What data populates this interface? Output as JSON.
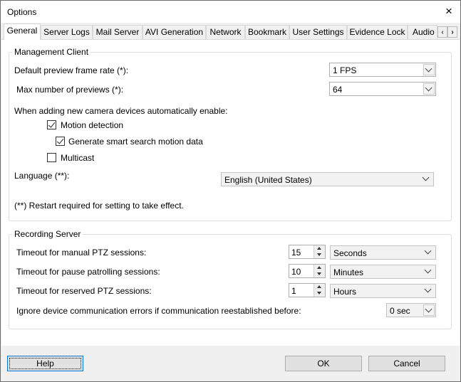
{
  "window": {
    "title": "Options"
  },
  "tabs": [
    {
      "label": "General",
      "active": true
    },
    {
      "label": "Server Logs"
    },
    {
      "label": "Mail Server"
    },
    {
      "label": "AVI Generation"
    },
    {
      "label": "Network"
    },
    {
      "label": "Bookmark"
    },
    {
      "label": "User Settings"
    },
    {
      "label": "Evidence Lock"
    },
    {
      "label": "Audio I"
    }
  ],
  "tab_scroll": {
    "left": "‹",
    "right": "›"
  },
  "management_client": {
    "title": "Management Client",
    "frame_rate_label": "Default preview frame rate (*):",
    "frame_rate_value": "1 FPS",
    "max_previews_label": "Max number of previews (*):",
    "max_previews_value": "64",
    "auto_enable_label": "When adding new camera devices automatically enable:",
    "motion_detection": {
      "label": "Motion detection",
      "checked": true
    },
    "smart_search": {
      "label": "Generate smart search motion data",
      "checked": true
    },
    "multicast": {
      "label": "Multicast",
      "checked": false
    },
    "language_label": "Language (**):",
    "language_value": "English (United States)",
    "restart_note": "(**) Restart required for setting to take effect."
  },
  "recording_server": {
    "title": "Recording Server",
    "manual_ptz_label": "Timeout for manual PTZ sessions:",
    "manual_ptz_value": "15",
    "manual_ptz_unit": "Seconds",
    "pause_patrol_label": "Timeout for pause patrolling sessions:",
    "pause_patrol_value": "10",
    "pause_patrol_unit": "Minutes",
    "reserved_ptz_label": "Timeout for reserved PTZ sessions:",
    "reserved_ptz_value": "1",
    "reserved_ptz_unit": "Hours",
    "ignore_errors_label": "Ignore device communication errors if communication reestablished before:",
    "ignore_errors_value": "0 sec"
  },
  "buttons": {
    "help": "Help",
    "ok": "OK",
    "cancel": "Cancel"
  },
  "icons": {
    "close": "×"
  }
}
